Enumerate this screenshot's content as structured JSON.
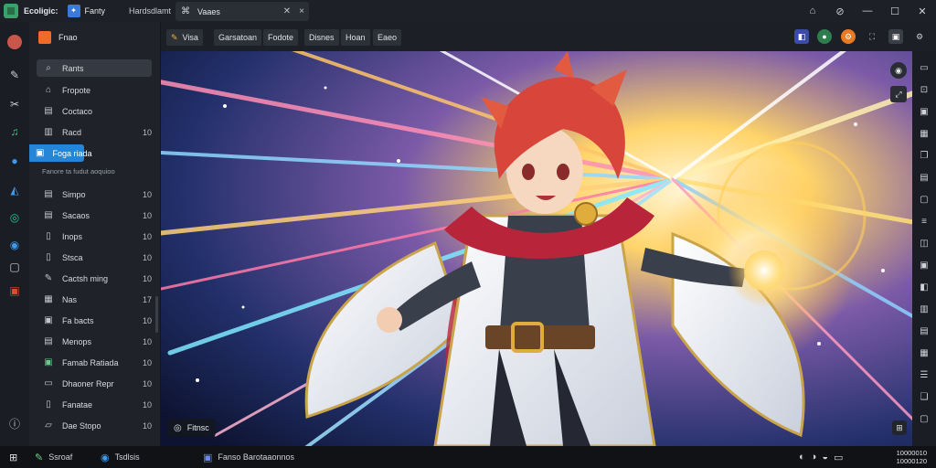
{
  "titlebar": {
    "title": "Ecoligic:",
    "app_name": "Fanty",
    "menu": "Hardsdlamt",
    "tab_label": "Vaaes",
    "controls": [
      "⌂",
      "⊘",
      "—",
      "☐",
      "✕"
    ]
  },
  "rail": {
    "icons": [
      "avatar",
      "brush-icon",
      "tools-icon",
      "music-icon",
      "globe-icon",
      "chart-icon",
      "map-icon",
      "clock-icon",
      "window-icon",
      "photo-icon"
    ],
    "info_icon": "info-icon"
  },
  "sidebar": {
    "header": "Fnao",
    "search_label": "Rants",
    "items": [
      {
        "label": "Fropote",
        "count": ""
      },
      {
        "label": "Coctaco",
        "count": ""
      },
      {
        "label": "Racd",
        "count": "10"
      },
      {
        "label": "Foga riada",
        "count": "",
        "active": true
      }
    ],
    "section_title": "Fanore ta fudut aoquioo",
    "list": [
      {
        "label": "Simpo",
        "count": "10"
      },
      {
        "label": "Sacaos",
        "count": "10"
      },
      {
        "label": "Inops",
        "count": "10"
      },
      {
        "label": "Stsca",
        "count": "10"
      },
      {
        "label": "Cactsh ming",
        "count": "10"
      },
      {
        "label": "Nas",
        "count": "17"
      },
      {
        "label": "Fa bacts",
        "count": "10"
      },
      {
        "label": "Menops",
        "count": "10"
      },
      {
        "label": "Famab Ratiada",
        "count": "10"
      },
      {
        "label": "Dhaoner Repr",
        "count": "10"
      },
      {
        "label": "Fanatae",
        "count": "10"
      },
      {
        "label": "Dae Stopo",
        "count": "10"
      }
    ]
  },
  "toolbar": {
    "buttons": [
      "Visa",
      "Garsatoan",
      "Fodote",
      "Disnes",
      "Hoan",
      "Eaeo"
    ]
  },
  "viewer": {
    "filename": "Fitnsc",
    "colors": {
      "hair": "#d8453a",
      "coat": "#eef0f4",
      "scarf": "#b8253b",
      "gold": "#e0ad3d"
    }
  },
  "statusbar": {
    "item1": "Ssroaf",
    "item2": "Tsdlsis",
    "item3": "Fanso Barotaaonnos",
    "clock_line1": "10000010",
    "clock_line2": "10000120"
  }
}
